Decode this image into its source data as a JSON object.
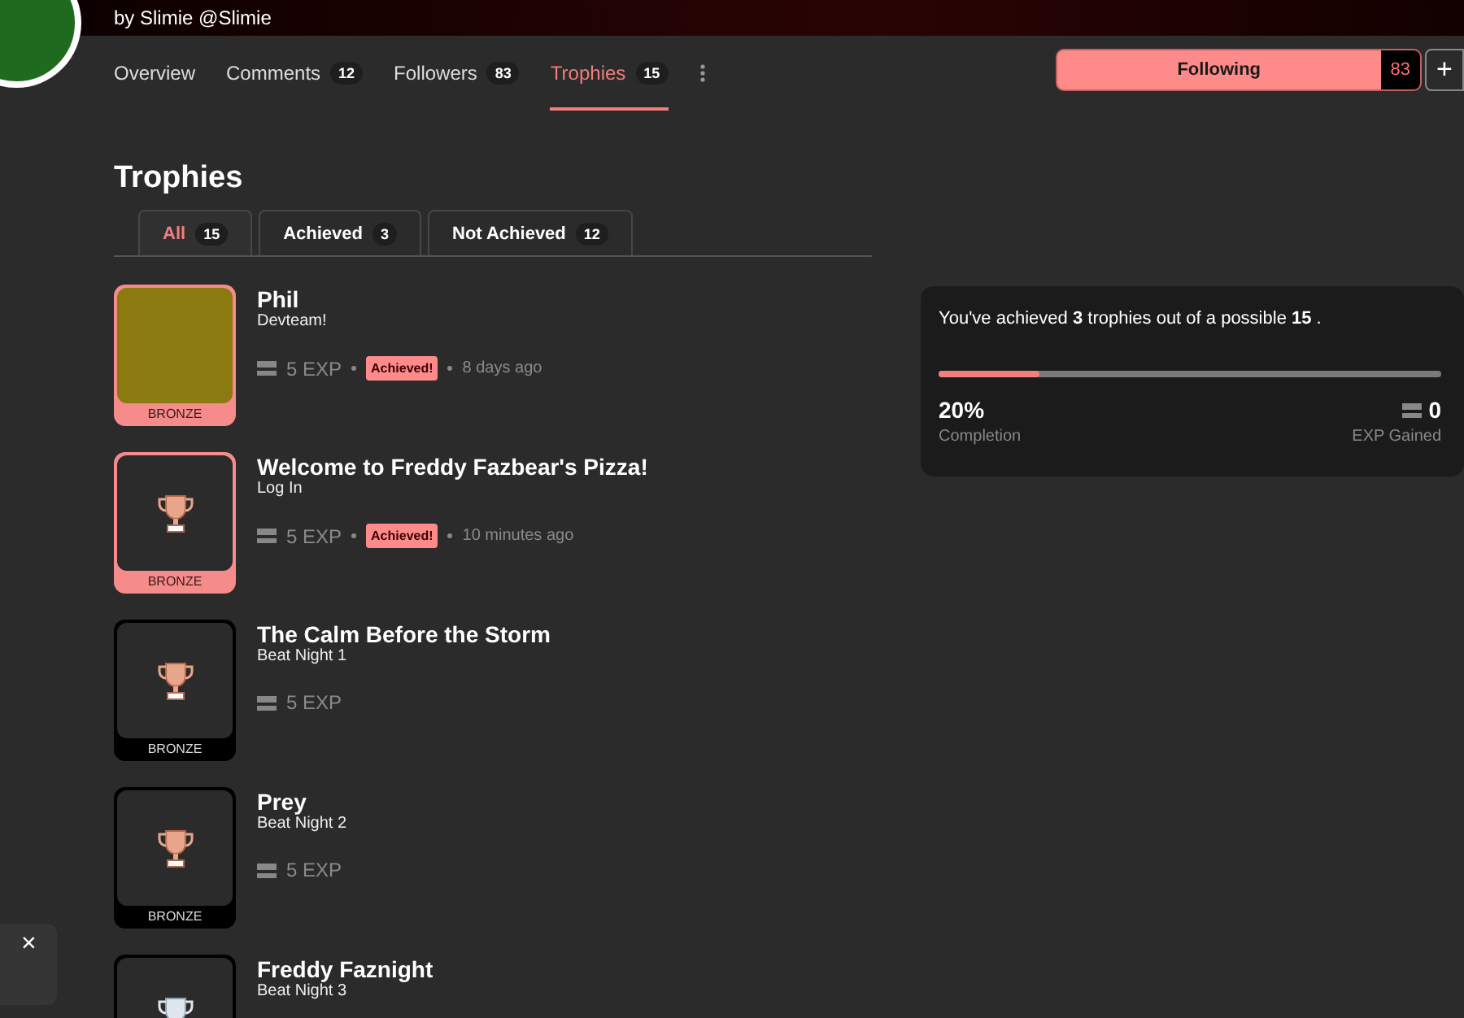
{
  "header": {
    "byline": "by Slimie @Slimie"
  },
  "nav": {
    "tabs": [
      {
        "label": "Overview",
        "selected": false
      },
      {
        "label": "Comments",
        "count": "12",
        "selected": false
      },
      {
        "label": "Followers",
        "count": "83",
        "selected": false
      },
      {
        "label": "Trophies",
        "count": "15",
        "selected": true
      }
    ],
    "follow": {
      "label": "Following",
      "count": "83",
      "add": "+"
    }
  },
  "heading": "Trophies",
  "filters": [
    {
      "label": "All",
      "count": "15",
      "selected": true
    },
    {
      "label": "Achieved",
      "count": "3",
      "selected": false
    },
    {
      "label": "Not Achieved",
      "count": "12",
      "selected": false
    }
  ],
  "trophies": [
    {
      "kind": "image",
      "title": "Phil",
      "subtitle": "Devteam!",
      "tier": "BRONZE",
      "exp": "5 EXP",
      "achieved": true,
      "status": "Achieved!",
      "time": "8 days ago"
    },
    {
      "kind": "bronze",
      "title": "Welcome to Freddy Fazbear's Pizza!",
      "subtitle": "Log In",
      "tier": "BRONZE",
      "exp": "5 EXP",
      "achieved": true,
      "status": "Achieved!",
      "time": "10 minutes ago"
    },
    {
      "kind": "bronze",
      "title": "The Calm Before the Storm",
      "subtitle": "Beat Night 1",
      "tier": "BRONZE",
      "exp": "5 EXP",
      "achieved": false
    },
    {
      "kind": "bronze",
      "title": "Prey",
      "subtitle": "Beat Night 2",
      "tier": "BRONZE",
      "exp": "5 EXP",
      "achieved": false
    },
    {
      "kind": "silver",
      "title": "Freddy Faznight",
      "subtitle": "Beat Night 3",
      "achieved": false
    }
  ],
  "summary": {
    "text": "You've achieved **3** trophies out of a possible **15** .",
    "level": 0.2,
    "percent": "20%",
    "percent_label": "Completion",
    "exp": "0",
    "exp_label": "EXP Gained"
  },
  "toast": {
    "close": "×"
  }
}
